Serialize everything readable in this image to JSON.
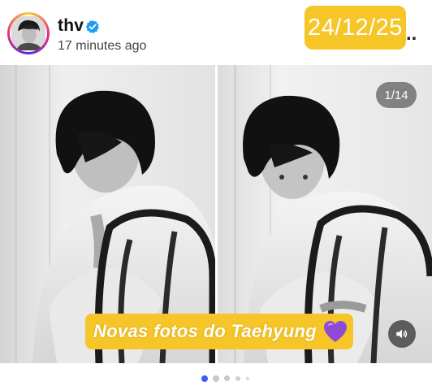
{
  "post": {
    "username": "thv",
    "time_ago": "17 minutes ago",
    "verified": true,
    "more_menu_icon": "more-horizontal-icon"
  },
  "overlay": {
    "date": "24/12/25",
    "caption": "Novas fotos do Taehyung",
    "caption_emoji": "purple-heart",
    "accent_color": "#f6c628"
  },
  "carousel": {
    "counter": "1/14",
    "current_index": 1,
    "total": 14,
    "sound_icon": "speaker-icon"
  },
  "colors": {
    "verified_blue": "#1d9bf0",
    "active_dot": "#3b5bff",
    "inactive_dot": "#c8c8c8"
  }
}
